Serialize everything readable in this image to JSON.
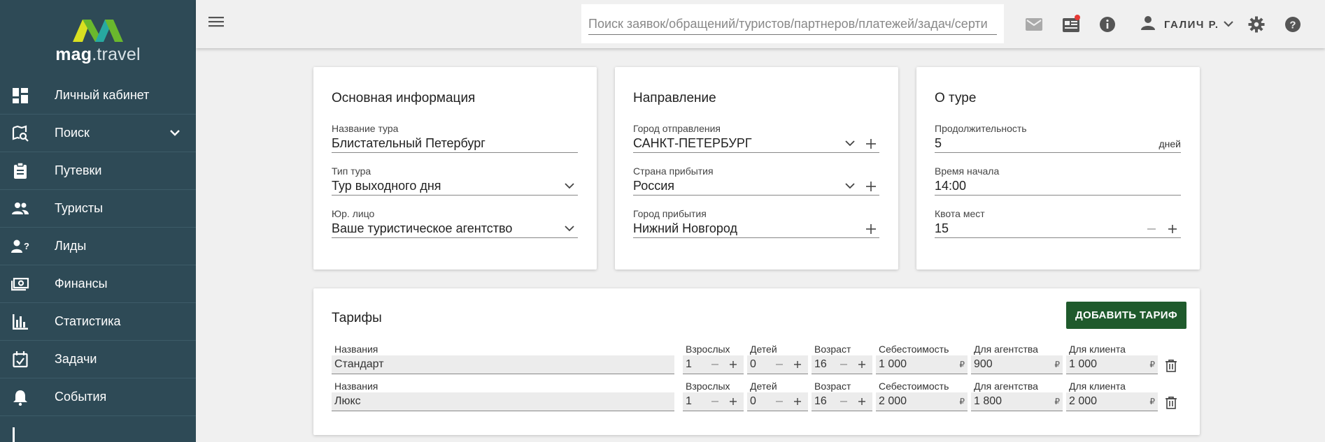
{
  "app": {
    "logo_text_bold": "mag",
    "logo_text_light": ".travel",
    "colors": {
      "sidebar": "#2e4a56",
      "accent": "#1f5a2c",
      "logo_green": "#6ab82d",
      "logo_yellow": "#d9e021",
      "logo_teal": "#27a9a0"
    }
  },
  "sidebar": {
    "items": [
      {
        "label": "Личный кабинет",
        "icon": "dashboard-icon"
      },
      {
        "label": "Поиск",
        "icon": "map-search-icon",
        "has_chevron": true
      },
      {
        "label": "Путевки",
        "icon": "clipboard-icon"
      },
      {
        "label": "Туристы",
        "icon": "people-icon"
      },
      {
        "label": "Лиды",
        "icon": "person-question-icon"
      },
      {
        "label": "Финансы",
        "icon": "money-icon"
      },
      {
        "label": "Статистика",
        "icon": "bar-chart-icon"
      },
      {
        "label": "Задачи",
        "icon": "calendar-check-icon"
      },
      {
        "label": "События",
        "icon": "bell-icon"
      }
    ]
  },
  "topbar": {
    "search_placeholder": "Поиск заявок/обращений/туристов/партнеров/платежей/задач/серти",
    "user_name": "ГАЛИЧ Р."
  },
  "basic_info": {
    "title": "Основная информация",
    "tour_name_label": "Название тура",
    "tour_name": "Блистательный Петербург",
    "tour_type_label": "Тип тура",
    "tour_type": "Тур выходного дня",
    "legal_entity_label": "Юр. лицо",
    "legal_entity": "Ваше туристическое агентство"
  },
  "direction": {
    "title": "Направление",
    "departure_city_label": "Город отправления",
    "departure_city": "САНКТ-ПЕТЕРБУРГ",
    "arrival_country_label": "Страна прибытия",
    "arrival_country": "Россия",
    "arrival_city_label": "Город прибытия",
    "arrival_city": "Нижний Новгород"
  },
  "about": {
    "title": "О туре",
    "duration_label": "Продолжительность",
    "duration": "5",
    "duration_unit": "дней",
    "start_time_label": "Время начала",
    "start_time": "14:00",
    "quota_label": "Квота мест",
    "quota": "15"
  },
  "tariffs": {
    "title": "Тарифы",
    "add_button": "ДОБАВИТЬ ТАРИФ",
    "col_labels": {
      "name": "Названия",
      "adults": "Взрослых",
      "children": "Детей",
      "age": "Возраст",
      "cost": "Себестоимость",
      "agency": "Для агентства",
      "client": "Для клиента"
    },
    "currency": "₽",
    "rows": [
      {
        "name": "Стандарт",
        "adults": "1",
        "children": "0",
        "age": "16",
        "cost": "1 000",
        "agency": "900",
        "client": "1 000"
      },
      {
        "name": "Люкс",
        "adults": "1",
        "children": "0",
        "age": "16",
        "cost": "2 000",
        "agency": "1 800",
        "client": "2 000"
      }
    ]
  }
}
